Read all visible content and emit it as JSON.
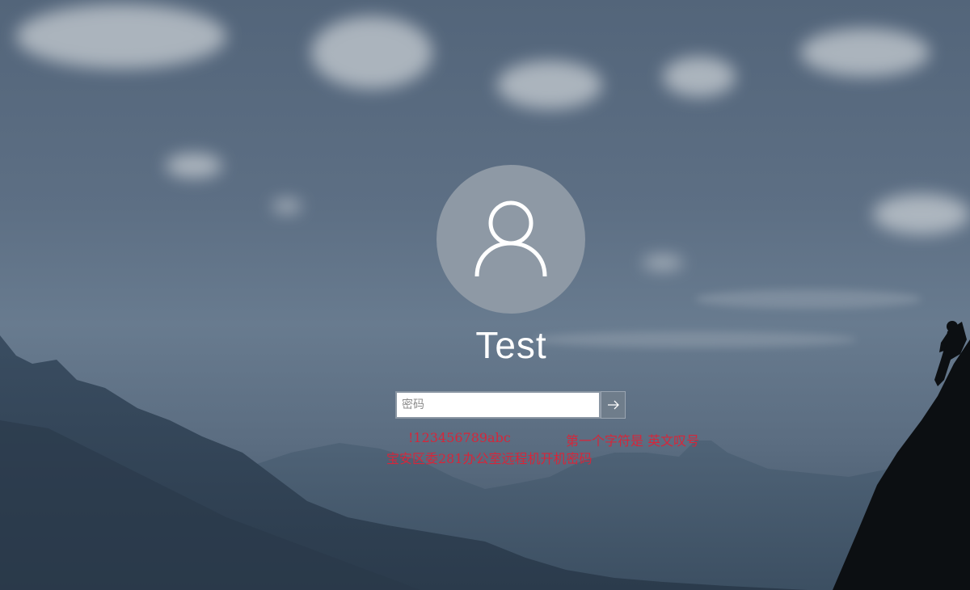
{
  "user": {
    "name": "Test"
  },
  "password": {
    "placeholder": "密码",
    "value": ""
  },
  "icons": {
    "avatar": "user-silhouette-icon",
    "submit": "arrow-right-icon"
  },
  "annotation": {
    "line1_left": "!123456789abc",
    "line1_right": "第一个字符是 英文叹号",
    "line2": "宝安区委281办公室远程机开机密码"
  },
  "colors": {
    "annotation": "#d6263a",
    "avatar_bg": "#8e99a5",
    "text": "#ffffff"
  }
}
